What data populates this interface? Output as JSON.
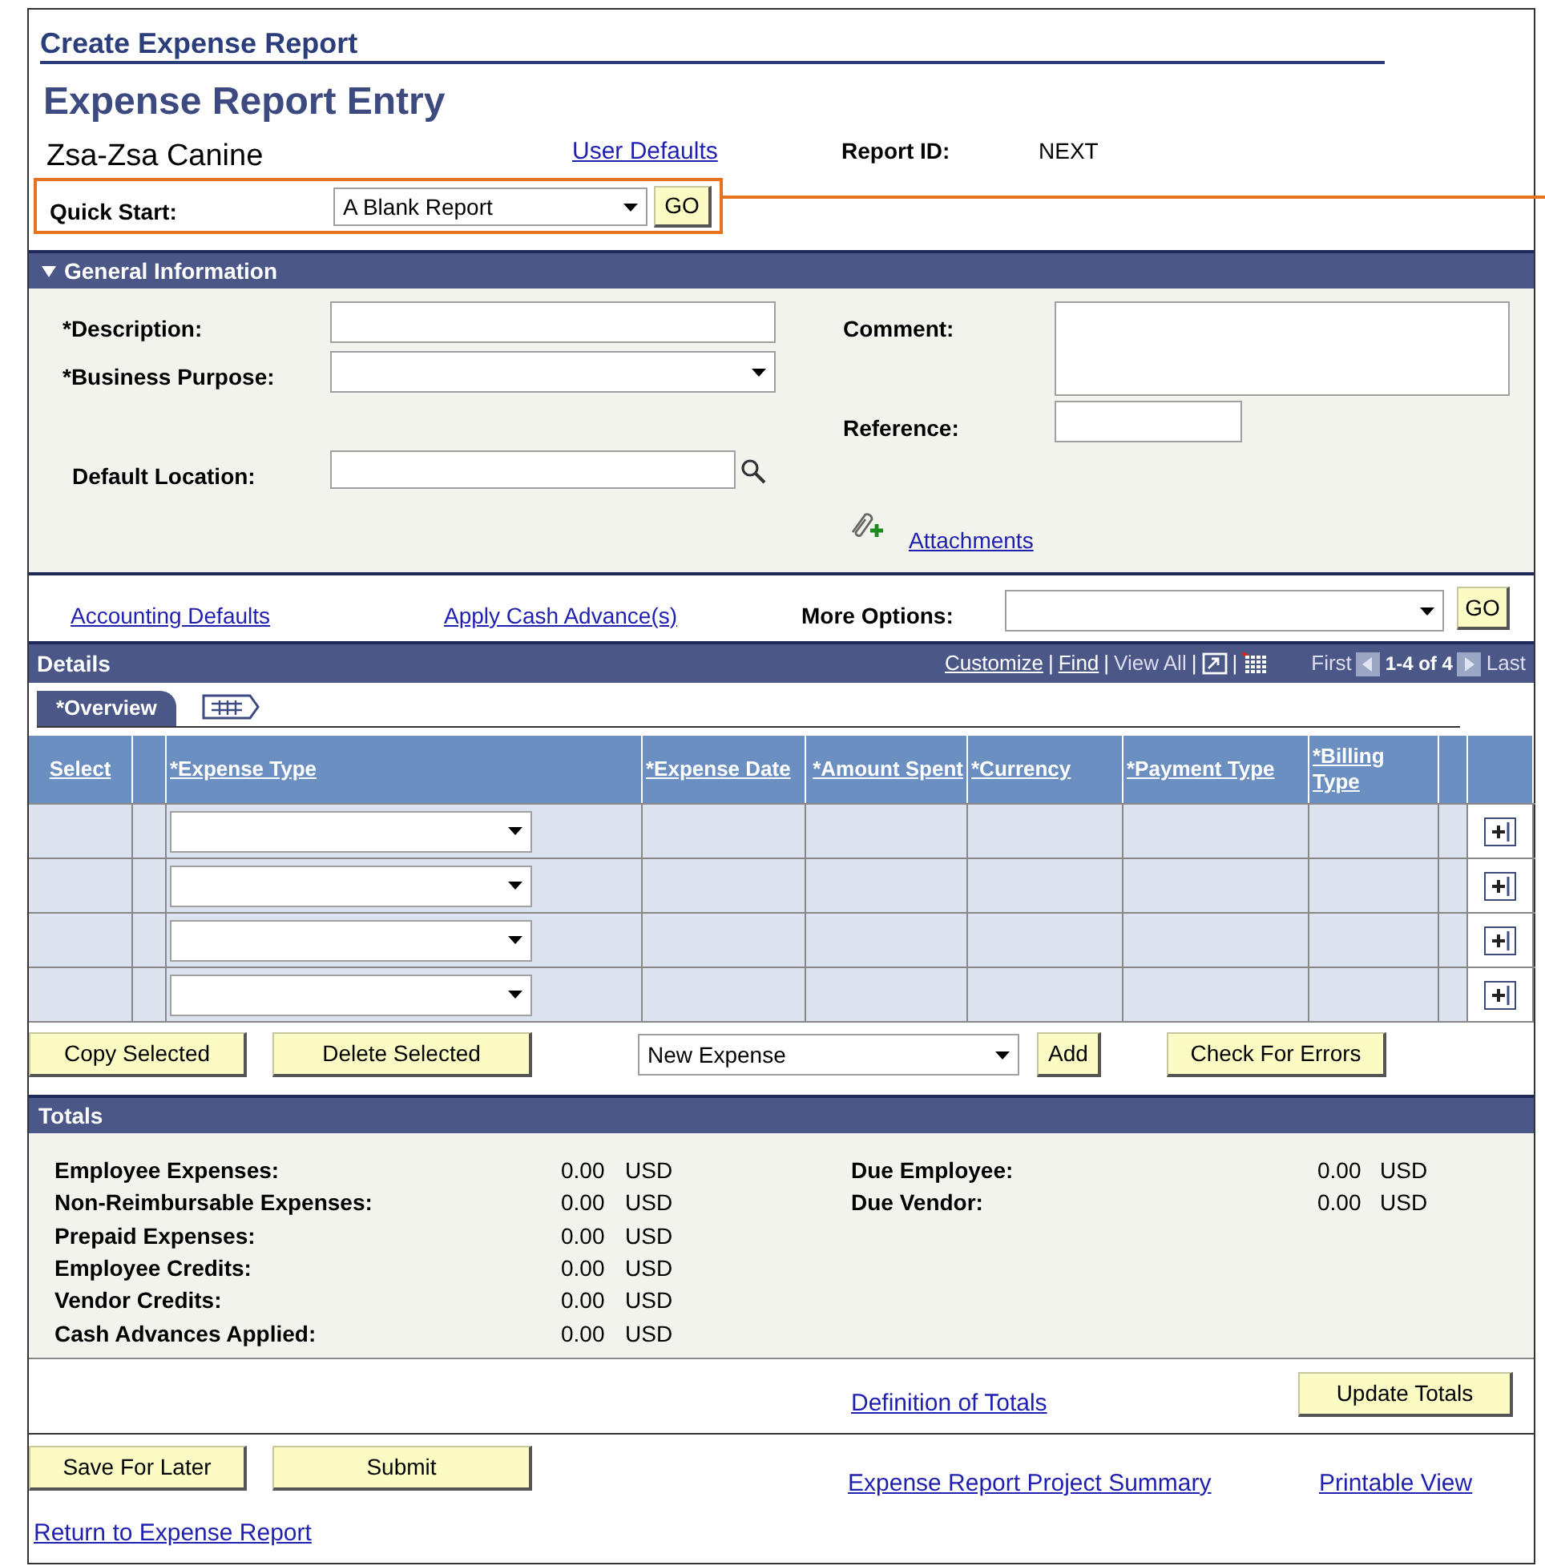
{
  "page_title": "Create Expense Report",
  "heading": "Expense Report Entry",
  "employee": "Zsa-Zsa Canine",
  "user_defaults_link": "User Defaults",
  "report_id": {
    "label": "Report ID:",
    "value": "NEXT"
  },
  "quick_start": {
    "label": "Quick Start:",
    "value": "A Blank Report",
    "button": "GO"
  },
  "general_information": {
    "title": "General Information",
    "expanded": true,
    "description": {
      "label": "*Description:"
    },
    "business_purpose": {
      "label": "*Business Purpose:"
    },
    "default_location": {
      "label": "Default Location:"
    },
    "comment": {
      "label": "Comment:"
    },
    "reference": {
      "label": "Reference:"
    },
    "attachments_link": "Attachments"
  },
  "options_bar": {
    "accounting_defaults_link": "Accounting Defaults",
    "apply_cash_advance_link": "Apply Cash Advance(s)",
    "more_options_label": "More Options:",
    "button": "GO"
  },
  "details": {
    "title": "Details",
    "toolbar": [
      {
        "text": "Customize",
        "kind": "link"
      },
      {
        "text": "|",
        "kind": "separator"
      },
      {
        "text": "Find",
        "kind": "link"
      },
      {
        "text": "|",
        "kind": "separator"
      },
      {
        "text": "View All",
        "kind": "plain"
      },
      {
        "text": "|",
        "kind": "separator"
      },
      {
        "kind": "zoom_icon"
      },
      {
        "text": "|",
        "kind": "separator"
      },
      {
        "kind": "grid_icon"
      }
    ],
    "pager": {
      "first": "First",
      "range": "1-4 of 4",
      "last": "Last"
    },
    "tabs": [
      {
        "label": "*Overview",
        "selected": true
      },
      {
        "kind": "icon",
        "selected": false
      }
    ],
    "columns": [
      {
        "label": "Select"
      },
      {
        "label": "*Expense Type"
      },
      {
        "label": "*Expense Date"
      },
      {
        "label": "*Amount Spent"
      },
      {
        "label": "*Currency"
      },
      {
        "label": "*Payment Type"
      },
      {
        "label": "*Billing Type"
      }
    ],
    "rows": [
      {
        "kind": "empty"
      },
      {
        "kind": "empty"
      },
      {
        "kind": "empty"
      },
      {
        "kind": "empty"
      }
    ],
    "copy_button": "Copy Selected",
    "delete_button": "Delete Selected",
    "new_expense": "New Expense",
    "add_button": "Add",
    "check_button": "Check For Errors"
  },
  "totals": {
    "title": "Totals",
    "left": [
      {
        "label": "Employee Expenses:",
        "amount": "0.00",
        "currency": "USD"
      },
      {
        "label": "Non-Reimbursable Expenses:",
        "amount": "0.00",
        "currency": "USD"
      },
      {
        "label": "Prepaid Expenses:",
        "amount": "0.00",
        "currency": "USD"
      },
      {
        "label": "Employee Credits:",
        "amount": "0.00",
        "currency": "USD"
      },
      {
        "label": "Vendor Credits:",
        "amount": "0.00",
        "currency": "USD"
      },
      {
        "label": "Cash Advances Applied:",
        "amount": "0.00",
        "currency": "USD"
      }
    ],
    "right": [
      {
        "label": "Due Employee:",
        "amount": "0.00",
        "currency": "USD"
      },
      {
        "label": "Due Vendor:",
        "amount": "0.00",
        "currency": "USD"
      }
    ],
    "definition_link": "Definition of Totals",
    "update_button": "Update Totals"
  },
  "footer": {
    "save_button": "Save For Later",
    "submit_button": "Submit",
    "summary_link": "Expense Report Project Summary",
    "printable_link": "Printable View",
    "return_link": "Return to Expense Report"
  }
}
